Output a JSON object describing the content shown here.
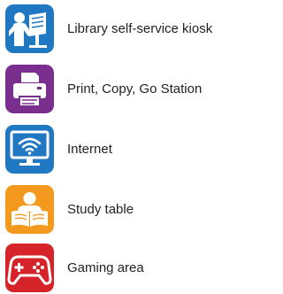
{
  "legend": {
    "items": [
      {
        "icon": "person-reading-at-kiosk-icon",
        "label": "Library self-service kiosk",
        "color": "#1f78c1"
      },
      {
        "icon": "printer-icon",
        "label": "Print, Copy, Go Station",
        "color": "#7a2f8f"
      },
      {
        "icon": "wifi-monitor-icon",
        "label": "Internet",
        "color": "#1f78c1"
      },
      {
        "icon": "person-reading-book-icon",
        "label": "Study table",
        "color": "#f39a1e"
      },
      {
        "icon": "game-controller-icon",
        "label": "Gaming area",
        "color": "#d6232a"
      }
    ]
  }
}
